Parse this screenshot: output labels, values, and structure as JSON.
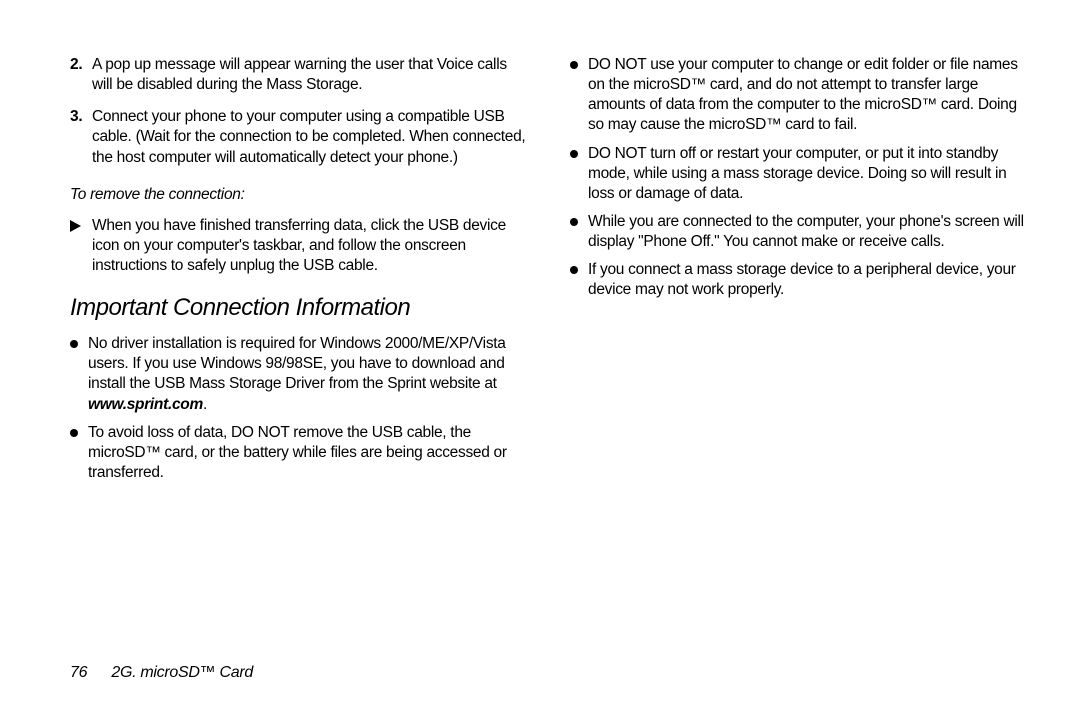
{
  "col1": {
    "step2_num": "2.",
    "step2_text": "A pop up message will appear warning the user that Voice calls will be disabled during the Mass Storage.",
    "step3_num": "3.",
    "step3_text": "Connect your phone to your computer using a compatible USB cable. (Wait for the connection to be completed. When connected, the host computer will automatically detect your phone.)",
    "remove_heading": "To remove the connection:",
    "remove_step": "When you have finished transferring data, click the USB device icon on your computer's taskbar, and follow the onscreen instructions to safely unplug the USB cable.",
    "section_heading": "Important Connection Information",
    "b1_pre": "No driver installation is required for Windows 2000/ME/XP/Vista users. If you use Windows 98/98SE, you have to download and install the USB Mass Storage Driver from the Sprint website at ",
    "b1_link": "www.sprint.com",
    "b1_post": ".",
    "b2": "To avoid loss of data, DO NOT remove the USB cable, the microSD™ card, or the battery while files are being accessed or transferred."
  },
  "col2": {
    "b1": "DO NOT use your computer to change or edit folder or file names on the microSD™ card, and do not attempt to transfer large amounts of data from the computer to the microSD™ card. Doing so may cause the microSD™ card to fail.",
    "b2": "DO NOT turn off or restart your computer, or put it into standby mode, while using a mass storage device. Doing so will result in loss or damage of data.",
    "b3": "While you are connected to the computer, your phone's screen will display \"Phone Off.\" You cannot make or receive calls.",
    "b4": "If you connect a mass storage device to a peripheral device, your device may not work properly."
  },
  "footer": {
    "page": "76",
    "section": "2G. microSD™ Card"
  }
}
